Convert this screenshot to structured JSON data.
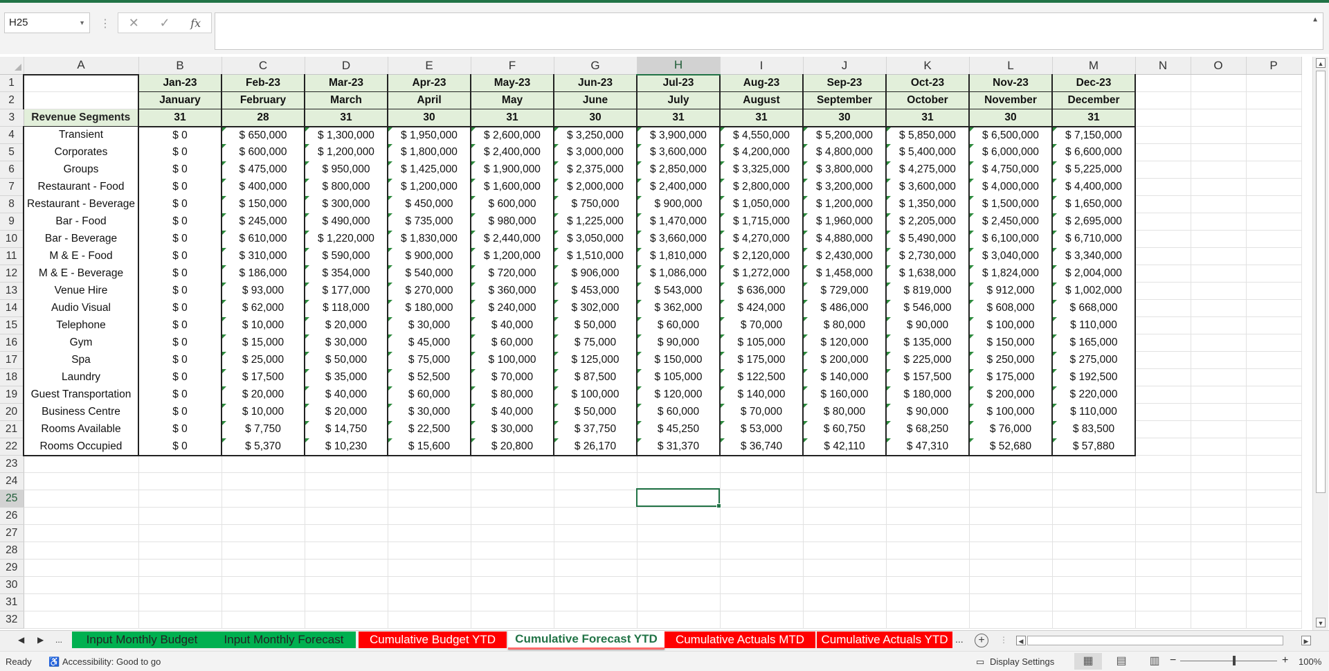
{
  "formula_bar": {
    "name_box": "H25",
    "cancel_icon": "✕",
    "enter_icon": "✓",
    "fx_label": "fx",
    "formula": ""
  },
  "columns": [
    "A",
    "B",
    "C",
    "D",
    "E",
    "F",
    "G",
    "H",
    "I",
    "J",
    "K",
    "L",
    "M",
    "N",
    "O",
    "P"
  ],
  "selected_column": "H",
  "rows": [
    "1",
    "2",
    "3",
    "4",
    "5",
    "6",
    "7",
    "8",
    "9",
    "10",
    "11",
    "12",
    "13",
    "14",
    "15",
    "16",
    "17",
    "18",
    "19",
    "20",
    "21",
    "22",
    "23",
    "24",
    "25",
    "26",
    "27",
    "28",
    "29",
    "30",
    "31",
    "32"
  ],
  "selected_row": "25",
  "month_codes": [
    "Jan-23",
    "Feb-23",
    "Mar-23",
    "Apr-23",
    "May-23",
    "Jun-23",
    "Jul-23",
    "Aug-23",
    "Sep-23",
    "Oct-23",
    "Nov-23",
    "Dec-23"
  ],
  "month_names": [
    "January",
    "February",
    "March",
    "April",
    "May",
    "June",
    "July",
    "August",
    "September",
    "October",
    "November",
    "December"
  ],
  "days_header": "Revenue Segments",
  "days": [
    "31",
    "28",
    "31",
    "30",
    "31",
    "30",
    "31",
    "31",
    "30",
    "31",
    "30",
    "31"
  ],
  "segments": [
    {
      "name": "Transient",
      "values": [
        "$ 0",
        "$ 650,000",
        "$ 1,300,000",
        "$ 1,950,000",
        "$ 2,600,000",
        "$ 3,250,000",
        "$ 3,900,000",
        "$ 4,550,000",
        "$ 5,200,000",
        "$ 5,850,000",
        "$ 6,500,000",
        "$ 7,150,000"
      ]
    },
    {
      "name": "Corporates",
      "values": [
        "$ 0",
        "$ 600,000",
        "$ 1,200,000",
        "$ 1,800,000",
        "$ 2,400,000",
        "$ 3,000,000",
        "$ 3,600,000",
        "$ 4,200,000",
        "$ 4,800,000",
        "$ 5,400,000",
        "$ 6,000,000",
        "$ 6,600,000"
      ]
    },
    {
      "name": "Groups",
      "values": [
        "$ 0",
        "$ 475,000",
        "$ 950,000",
        "$ 1,425,000",
        "$ 1,900,000",
        "$ 2,375,000",
        "$ 2,850,000",
        "$ 3,325,000",
        "$ 3,800,000",
        "$ 4,275,000",
        "$ 4,750,000",
        "$ 5,225,000"
      ]
    },
    {
      "name": "Restaurant - Food",
      "values": [
        "$ 0",
        "$ 400,000",
        "$ 800,000",
        "$ 1,200,000",
        "$ 1,600,000",
        "$ 2,000,000",
        "$ 2,400,000",
        "$ 2,800,000",
        "$ 3,200,000",
        "$ 3,600,000",
        "$ 4,000,000",
        "$ 4,400,000"
      ]
    },
    {
      "name": "Restaurant - Beverage",
      "values": [
        "$ 0",
        "$ 150,000",
        "$ 300,000",
        "$ 450,000",
        "$ 600,000",
        "$ 750,000",
        "$ 900,000",
        "$ 1,050,000",
        "$ 1,200,000",
        "$ 1,350,000",
        "$ 1,500,000",
        "$ 1,650,000"
      ]
    },
    {
      "name": "Bar - Food",
      "values": [
        "$ 0",
        "$ 245,000",
        "$ 490,000",
        "$ 735,000",
        "$ 980,000",
        "$ 1,225,000",
        "$ 1,470,000",
        "$ 1,715,000",
        "$ 1,960,000",
        "$ 2,205,000",
        "$ 2,450,000",
        "$ 2,695,000"
      ]
    },
    {
      "name": "Bar - Beverage",
      "values": [
        "$ 0",
        "$ 610,000",
        "$ 1,220,000",
        "$ 1,830,000",
        "$ 2,440,000",
        "$ 3,050,000",
        "$ 3,660,000",
        "$ 4,270,000",
        "$ 4,880,000",
        "$ 5,490,000",
        "$ 6,100,000",
        "$ 6,710,000"
      ]
    },
    {
      "name": "M & E - Food",
      "values": [
        "$ 0",
        "$ 310,000",
        "$ 590,000",
        "$ 900,000",
        "$ 1,200,000",
        "$ 1,510,000",
        "$ 1,810,000",
        "$ 2,120,000",
        "$ 2,430,000",
        "$ 2,730,000",
        "$ 3,040,000",
        "$ 3,340,000"
      ]
    },
    {
      "name": "M & E - Beverage",
      "values": [
        "$ 0",
        "$ 186,000",
        "$ 354,000",
        "$ 540,000",
        "$ 720,000",
        "$ 906,000",
        "$ 1,086,000",
        "$ 1,272,000",
        "$ 1,458,000",
        "$ 1,638,000",
        "$ 1,824,000",
        "$ 2,004,000"
      ]
    },
    {
      "name": "Venue Hire",
      "values": [
        "$ 0",
        "$ 93,000",
        "$ 177,000",
        "$ 270,000",
        "$ 360,000",
        "$ 453,000",
        "$ 543,000",
        "$ 636,000",
        "$ 729,000",
        "$ 819,000",
        "$ 912,000",
        "$ 1,002,000"
      ]
    },
    {
      "name": "Audio Visual",
      "values": [
        "$ 0",
        "$ 62,000",
        "$ 118,000",
        "$ 180,000",
        "$ 240,000",
        "$ 302,000",
        "$ 362,000",
        "$ 424,000",
        "$ 486,000",
        "$ 546,000",
        "$ 608,000",
        "$ 668,000"
      ]
    },
    {
      "name": "Telephone",
      "values": [
        "$ 0",
        "$ 10,000",
        "$ 20,000",
        "$ 30,000",
        "$ 40,000",
        "$ 50,000",
        "$ 60,000",
        "$ 70,000",
        "$ 80,000",
        "$ 90,000",
        "$ 100,000",
        "$ 110,000"
      ]
    },
    {
      "name": "Gym",
      "values": [
        "$ 0",
        "$ 15,000",
        "$ 30,000",
        "$ 45,000",
        "$ 60,000",
        "$ 75,000",
        "$ 90,000",
        "$ 105,000",
        "$ 120,000",
        "$ 135,000",
        "$ 150,000",
        "$ 165,000"
      ]
    },
    {
      "name": "Spa",
      "values": [
        "$ 0",
        "$ 25,000",
        "$ 50,000",
        "$ 75,000",
        "$ 100,000",
        "$ 125,000",
        "$ 150,000",
        "$ 175,000",
        "$ 200,000",
        "$ 225,000",
        "$ 250,000",
        "$ 275,000"
      ]
    },
    {
      "name": "Laundry",
      "values": [
        "$ 0",
        "$ 17,500",
        "$ 35,000",
        "$ 52,500",
        "$ 70,000",
        "$ 87,500",
        "$ 105,000",
        "$ 122,500",
        "$ 140,000",
        "$ 157,500",
        "$ 175,000",
        "$ 192,500"
      ]
    },
    {
      "name": "Guest Transportation",
      "values": [
        "$ 0",
        "$ 20,000",
        "$ 40,000",
        "$ 60,000",
        "$ 80,000",
        "$ 100,000",
        "$ 120,000",
        "$ 140,000",
        "$ 160,000",
        "$ 180,000",
        "$ 200,000",
        "$ 220,000"
      ]
    },
    {
      "name": "Business Centre",
      "values": [
        "$ 0",
        "$ 10,000",
        "$ 20,000",
        "$ 30,000",
        "$ 40,000",
        "$ 50,000",
        "$ 60,000",
        "$ 70,000",
        "$ 80,000",
        "$ 90,000",
        "$ 100,000",
        "$ 110,000"
      ]
    },
    {
      "name": "Rooms Available",
      "values": [
        "$ 0",
        "$ 7,750",
        "$ 14,750",
        "$ 22,500",
        "$ 30,000",
        "$ 37,750",
        "$ 45,250",
        "$ 53,000",
        "$ 60,750",
        "$ 68,250",
        "$ 76,000",
        "$ 83,500"
      ]
    },
    {
      "name": "Rooms Occupied",
      "values": [
        "$ 0",
        "$ 5,370",
        "$ 10,230",
        "$ 15,600",
        "$ 20,800",
        "$ 26,170",
        "$ 31,370",
        "$ 36,740",
        "$ 42,110",
        "$ 47,310",
        "$ 52,680",
        "$ 57,880"
      ]
    }
  ],
  "sheet_tabs": [
    {
      "label": "Input Monthly Budget",
      "color": "green"
    },
    {
      "label": "Input Monthly Forecast",
      "color": "green"
    },
    {
      "label": "Cumulative Budget YTD",
      "color": "red"
    },
    {
      "label": "Cumulative Forecast YTD",
      "color": "active"
    },
    {
      "label": "Cumulative Actuals MTD",
      "color": "red"
    },
    {
      "label": "Cumulative Actuals YTD",
      "color": "red"
    }
  ],
  "tab_nav": {
    "prev": "◀",
    "next": "▶",
    "more": "...",
    "overflow": "..."
  },
  "status": {
    "ready": "Ready",
    "accessibility": "Accessibility: Good to go",
    "display_settings": "Display Settings",
    "zoom": "100%",
    "zoom_minus": "−",
    "zoom_plus": "+"
  },
  "colors": {
    "header_fill": "#e2efda",
    "accent": "#217346",
    "tab_green": "#00b050",
    "tab_red": "#ff0000"
  }
}
